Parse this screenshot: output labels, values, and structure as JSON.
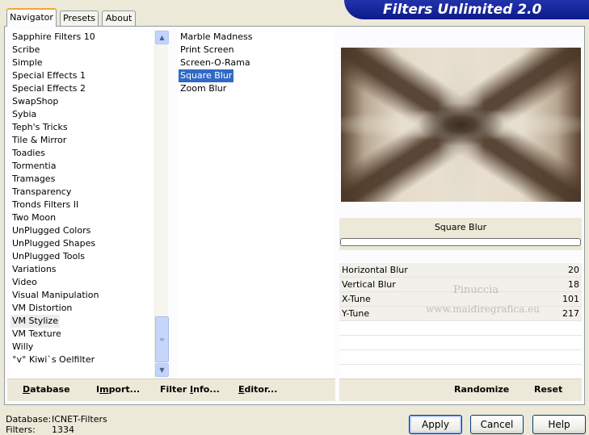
{
  "banner": {
    "title": "Filters Unlimited 2.0"
  },
  "tabs": [
    {
      "label": "Navigator",
      "active": true
    },
    {
      "label": "Presets",
      "active": false
    },
    {
      "label": "About",
      "active": false
    }
  ],
  "categories": {
    "items": [
      "Sapphire Filters 10",
      "Scribe",
      "Simple",
      "Special Effects 1",
      "Special Effects 2",
      "SwapShop",
      "Sybia",
      "Teph's Tricks",
      "Tile & Mirror",
      "Toadies",
      "Tormentia",
      "Tramages",
      "Transparency",
      "Tronds Filters II",
      "Two Moon",
      "UnPlugged Colors",
      "UnPlugged Shapes",
      "UnPlugged Tools",
      "Variations",
      "Video",
      "Visual Manipulation",
      "VM Distortion",
      "VM Stylize",
      "VM Texture",
      "Willy",
      "°v° Kiwi`s Oelfilter"
    ],
    "selected": "VM Stylize"
  },
  "filters": {
    "items": [
      "Marble Madness",
      "Print Screen",
      "Screen-O-Rama",
      "Square Blur",
      "Zoom Blur"
    ],
    "selected": "Square Blur"
  },
  "left_buttons": {
    "database": {
      "underlined": "D",
      "rest": "atabase"
    },
    "import": {
      "before": "I",
      "underlined": "m",
      "rest": "port..."
    },
    "filter_info": {
      "before": "Filter ",
      "underlined": "I",
      "rest": "nfo..."
    },
    "editor": {
      "underlined": "E",
      "rest": "ditor..."
    }
  },
  "right_buttons": {
    "randomize": "Randomize",
    "reset": "Reset"
  },
  "filter_title": "Square Blur",
  "parameters": [
    {
      "label": "Horizontal Blur",
      "value": "20"
    },
    {
      "label": "Vertical Blur",
      "value": "18"
    },
    {
      "label": "X-Tune",
      "value": "101"
    },
    {
      "label": "Y-Tune",
      "value": "217"
    }
  ],
  "watermark": {
    "line1": "Pinuccia",
    "line2": "www.maidiregrafica.eu"
  },
  "footer": {
    "database_label": "Database:",
    "database_value": "ICNET-Filters",
    "filters_label": "Filters:",
    "filters_value": "1334"
  },
  "dialog_buttons": {
    "apply": "Apply",
    "cancel": "Cancel",
    "help": "Help"
  },
  "icons": {
    "scroll_up": "chevron-up-icon",
    "scroll_down": "chevron-down-icon",
    "scroll_grip": "grip-icon"
  },
  "colors": {
    "banner_blue": "#0c1b8a",
    "selection_blue": "#316ac5",
    "dialog_bg": "#ece9d8"
  }
}
